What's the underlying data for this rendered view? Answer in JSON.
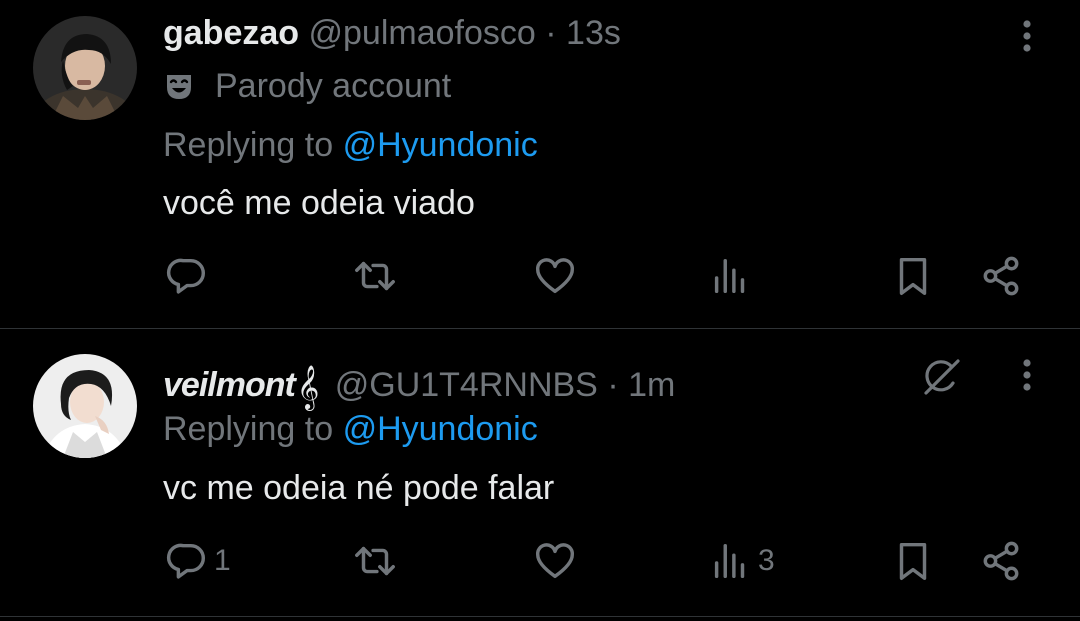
{
  "tweets": [
    {
      "display_name": "gabezao",
      "handle": "@pulmaofosco",
      "separator": "·",
      "time": "13s",
      "parody_label": "Parody account",
      "replying_prefix": "Replying to",
      "replying_to": "@Hyundonic",
      "text": "você me odeia viado",
      "counts": {
        "reply": "",
        "retweet": "",
        "like": "",
        "views": ""
      }
    },
    {
      "display_name": "veilmont",
      "display_name_emoji": "𝄞",
      "handle": "@GU1T4RNNBS",
      "separator": "·",
      "time": "1m",
      "replying_prefix": "Replying to",
      "replying_to": "@Hyundonic",
      "text": "vc me odeia né pode falar",
      "counts": {
        "reply": "1",
        "retweet": "",
        "like": "",
        "views": "3"
      }
    }
  ],
  "icons": {
    "more": "more-vertical-icon",
    "parody": "theater-mask-icon",
    "grok": "grok-icon",
    "reply": "reply-icon",
    "retweet": "retweet-icon",
    "like": "heart-icon",
    "views": "views-icon",
    "bookmark": "bookmark-icon",
    "share": "share-icon"
  },
  "colors": {
    "background": "#000000",
    "text_primary": "#e7e9ea",
    "text_secondary": "#71767b",
    "link": "#1d9bf0",
    "divider": "#2f3336"
  }
}
